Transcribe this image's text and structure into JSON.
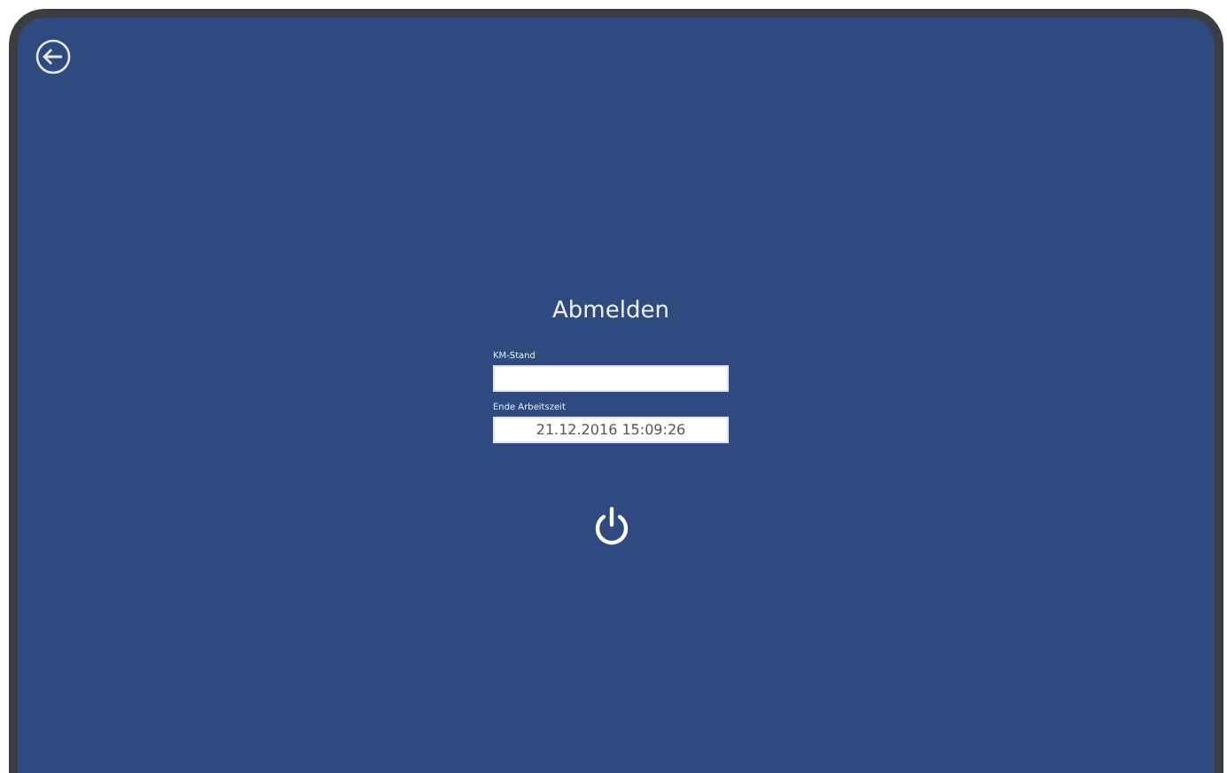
{
  "screen": {
    "title": "Abmelden",
    "fields": [
      {
        "label": "KM-Stand"
      },
      {
        "label": "Ende Arbeitszeit",
        "value": "21.12.2016 15:09:26"
      }
    ]
  }
}
